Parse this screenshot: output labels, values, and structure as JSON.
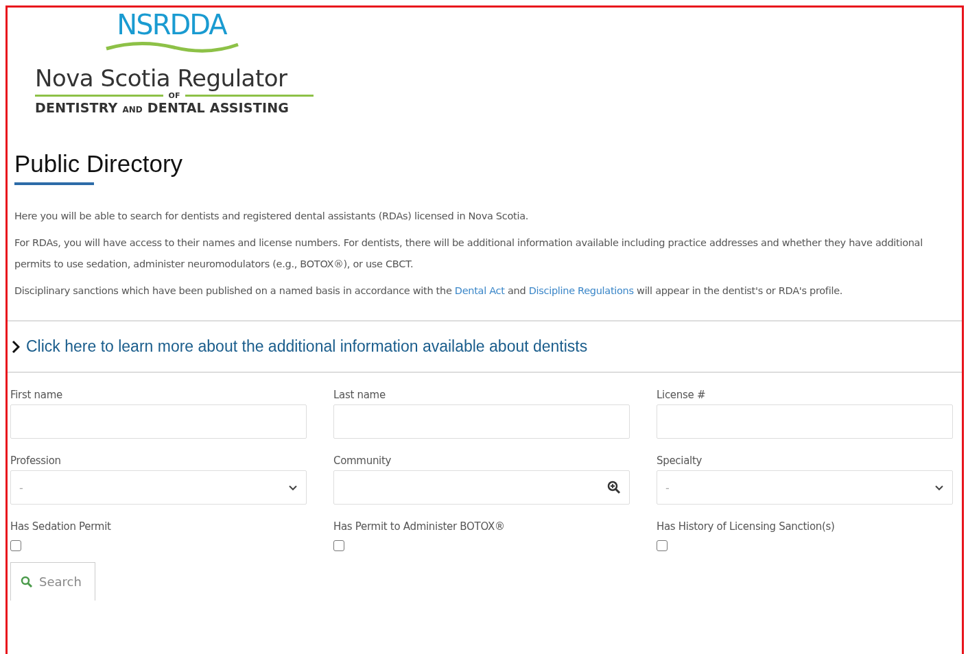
{
  "logo": {
    "acronym": "NSRDDA",
    "name": "Nova Scotia Regulator",
    "connector": "OF",
    "subtitle_start": "DENTISTRY",
    "subtitle_and": "AND",
    "subtitle_end": "DENTAL ASSISTING"
  },
  "heading": "Public Directory",
  "paragraphs": [
    {
      "text": "Here you will be able to search for dentists and registered dental assistants (RDAs) licensed in Nova Scotia."
    },
    {
      "text": "For RDAs, you will have access to their names and license numbers. For dentists, there will be additional information available including practice addresses and whether they have additional permits to use sedation, administer neuromodulators (e.g., BOTOX®), or use CBCT."
    },
    {
      "before": "Disciplinary sanctions which have been published on a named basis in accordance with the ",
      "link1": "Dental Act",
      "middle": " and ",
      "link2": "Discipline Regulations",
      "after": " will appear in the dentist's or RDA's profile."
    }
  ],
  "expander": {
    "label": "Click here to learn more about the additional information available about dentists",
    "expanded": false
  },
  "fields": [
    {
      "kind": "text",
      "label": "First name"
    },
    {
      "kind": "text",
      "label": "Last name"
    },
    {
      "kind": "text",
      "label": "License #"
    },
    {
      "kind": "select",
      "label": "Profession",
      "value": "-"
    },
    {
      "kind": "lookup",
      "label": "Community"
    },
    {
      "kind": "select",
      "label": "Specialty",
      "value": "-"
    },
    {
      "kind": "checkbox",
      "label": "Has Sedation Permit",
      "checked": false
    },
    {
      "kind": "checkbox",
      "label": "Has Permit to Administer BOTOX®",
      "checked": false
    },
    {
      "kind": "checkbox",
      "label": "Has History of Licensing Sanction(s)",
      "checked": false
    }
  ],
  "search_button": "Search"
}
